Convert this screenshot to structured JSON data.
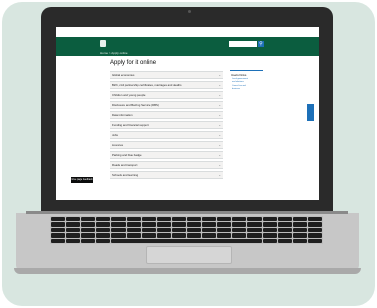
{
  "header": {
    "breadcrumb": "Home > Apply online"
  },
  "page": {
    "title": "Apply for it online"
  },
  "topics": [
    "Global economies",
    "Birth, civil partnership certificates, marriages and deaths",
    "Children and young people",
    "Disclosure and Barring Service (DBS)",
    "Data information",
    "Funding and financial support",
    "Jobs",
    "Licences",
    "Parking and blue badge",
    "Roads and transport",
    "Schools and learning"
  ],
  "related": {
    "title": "Useful links",
    "links": [
      "Local government",
      "and elections",
      "Council tax and",
      "business"
    ]
  },
  "feedback": {
    "label": "Give page feedback"
  },
  "colors": {
    "header": "#0b5d3f",
    "accent": "#1d70b8",
    "background_card": "#d8e6e0"
  },
  "icons": {
    "search": "magnifier",
    "chevron": "chevron-down"
  }
}
